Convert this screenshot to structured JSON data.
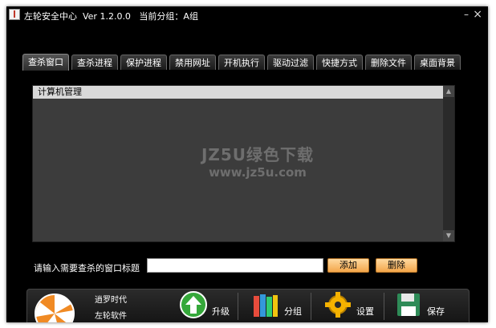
{
  "window": {
    "title": "左轮安全中心  Ver 1.2.0.0   当前分组：A组",
    "minimize_glyph": "–",
    "close_glyph": "×"
  },
  "tabs": [
    {
      "label": "查杀窗口",
      "active": true
    },
    {
      "label": "查杀进程"
    },
    {
      "label": "保护进程"
    },
    {
      "label": "禁用网址"
    },
    {
      "label": "开机执行"
    },
    {
      "label": "驱动过滤"
    },
    {
      "label": "快捷方式"
    },
    {
      "label": "删除文件"
    },
    {
      "label": "桌面背景"
    }
  ],
  "list": {
    "header": "计算机管理"
  },
  "watermark": {
    "line1": "JZ5U绿色下载",
    "line2": "www.jz5u.com"
  },
  "input": {
    "label": "请输入需要查杀的窗口标题",
    "value": "",
    "add_label": "添加",
    "delete_label": "删除"
  },
  "footer": {
    "brand_line1": "逍罗时代",
    "brand_line2": "左轮软件",
    "upgrade_label": "升级",
    "group_label": "分组",
    "settings_label": "设置",
    "save_label": "保存",
    "icons": [
      "logo-icon",
      "upgrade-arrow-icon",
      "books-icon",
      "gear-icon",
      "floppy-disk-icon"
    ]
  },
  "colors": {
    "background": "#000000",
    "list_bg": "#3c3c3c",
    "button_orange": "#f3a64a",
    "upgrade_green": "#35a83a"
  }
}
